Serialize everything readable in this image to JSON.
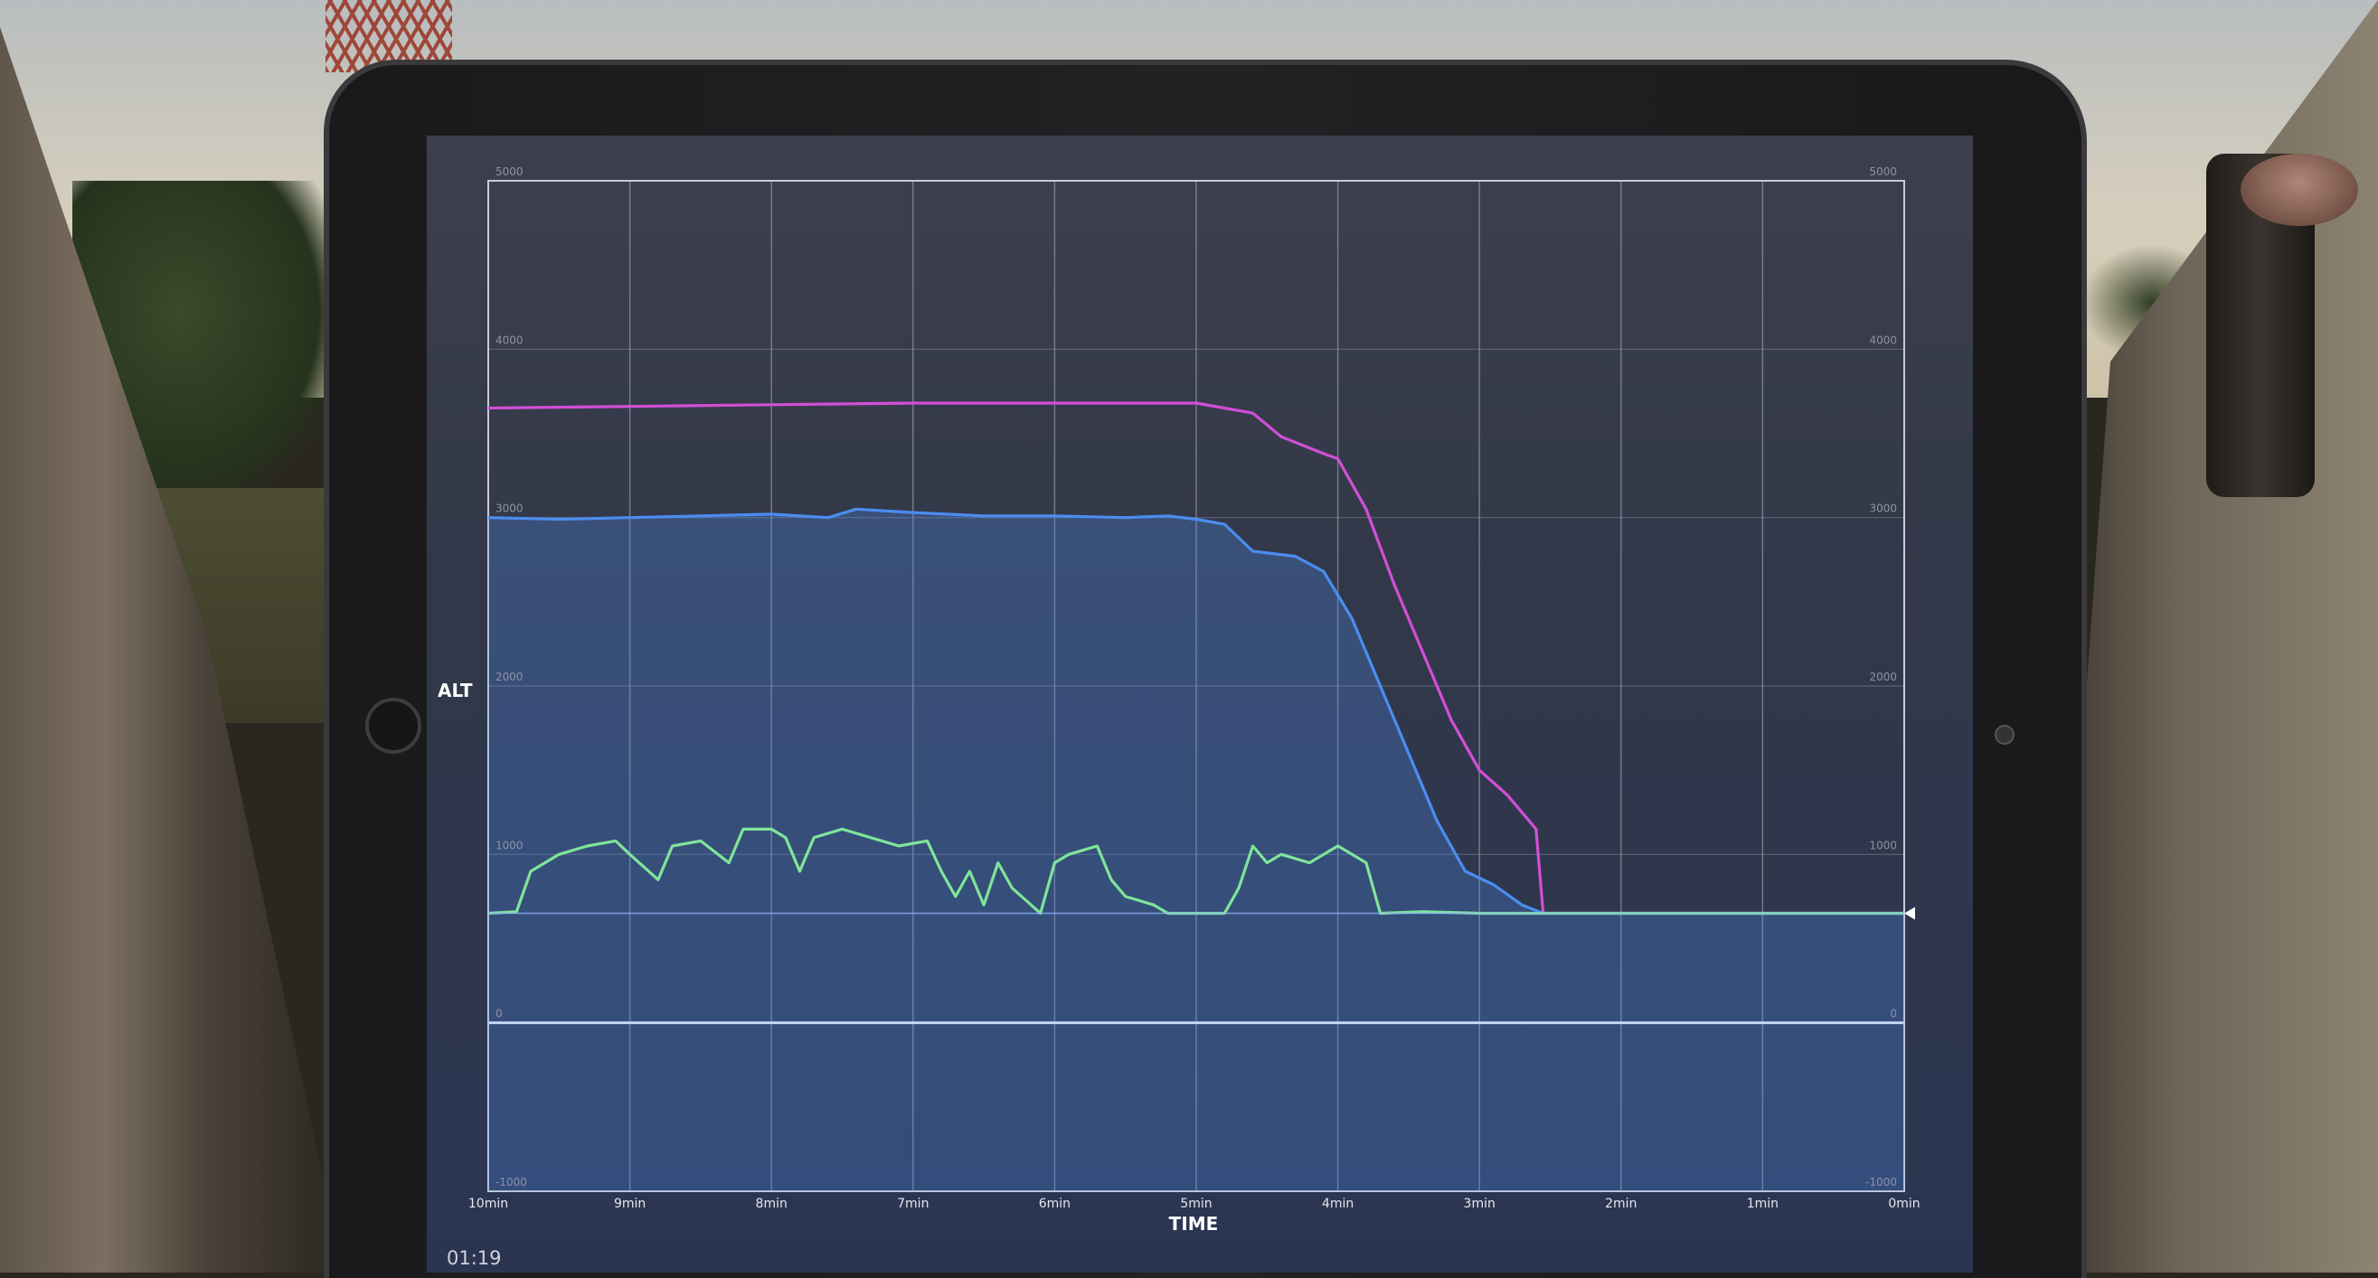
{
  "screen": {
    "clock": "01:19"
  },
  "chart_data": {
    "type": "line",
    "title": "",
    "xlabel": "TIME",
    "ylabel": "ALT",
    "x_tick_labels": [
      "10min",
      "9min",
      "8min",
      "7min",
      "6min",
      "5min",
      "4min",
      "3min",
      "2min",
      "1min",
      "0min"
    ],
    "y_tick_labels": [
      "5000",
      "4000",
      "3000",
      "2000",
      "1000",
      "0",
      "-1000"
    ],
    "xlim": [
      10,
      0
    ],
    "ylim": [
      -1000,
      5000
    ],
    "grid": true,
    "current_marker": {
      "x": 0,
      "y": 650
    },
    "series": [
      {
        "color": "#d24fd6",
        "points": [
          [
            10,
            3650
          ],
          [
            9,
            3660
          ],
          [
            8,
            3670
          ],
          [
            7,
            3680
          ],
          [
            6,
            3680
          ],
          [
            5.5,
            3680
          ],
          [
            5.0,
            3680
          ],
          [
            4.6,
            3620
          ],
          [
            4.4,
            3480
          ],
          [
            4.1,
            3380
          ],
          [
            4.0,
            3350
          ],
          [
            3.8,
            3050
          ],
          [
            3.6,
            2600
          ],
          [
            3.4,
            2200
          ],
          [
            3.2,
            1800
          ],
          [
            3.0,
            1500
          ],
          [
            2.8,
            1350
          ],
          [
            2.6,
            1150
          ],
          [
            2.55,
            650
          ],
          [
            2,
            650
          ],
          [
            1,
            650
          ],
          [
            0,
            650
          ]
        ]
      },
      {
        "color": "#4b8df0",
        "fill": true,
        "points": [
          [
            10,
            3000
          ],
          [
            9.5,
            2990
          ],
          [
            9,
            3000
          ],
          [
            8.5,
            3010
          ],
          [
            8,
            3020
          ],
          [
            7.6,
            3000
          ],
          [
            7.4,
            3050
          ],
          [
            7,
            3030
          ],
          [
            6.5,
            3010
          ],
          [
            6,
            3010
          ],
          [
            5.5,
            3000
          ],
          [
            5.2,
            3010
          ],
          [
            5.0,
            2990
          ],
          [
            4.8,
            2960
          ],
          [
            4.6,
            2800
          ],
          [
            4.3,
            2770
          ],
          [
            4.1,
            2680
          ],
          [
            3.9,
            2400
          ],
          [
            3.7,
            2000
          ],
          [
            3.5,
            1600
          ],
          [
            3.3,
            1200
          ],
          [
            3.1,
            900
          ],
          [
            2.9,
            820
          ],
          [
            2.7,
            700
          ],
          [
            2.55,
            650
          ],
          [
            2,
            650
          ],
          [
            1,
            650
          ],
          [
            0,
            650
          ]
        ]
      },
      {
        "color": "#7ee59a",
        "points": [
          [
            10,
            650
          ],
          [
            9.8,
            660
          ],
          [
            9.7,
            900
          ],
          [
            9.5,
            1000
          ],
          [
            9.3,
            1050
          ],
          [
            9.1,
            1080
          ],
          [
            9.0,
            1000
          ],
          [
            8.8,
            850
          ],
          [
            8.7,
            1050
          ],
          [
            8.5,
            1080
          ],
          [
            8.3,
            950
          ],
          [
            8.2,
            1150
          ],
          [
            8.0,
            1150
          ],
          [
            7.9,
            1100
          ],
          [
            7.8,
            900
          ],
          [
            7.7,
            1100
          ],
          [
            7.5,
            1150
          ],
          [
            7.3,
            1100
          ],
          [
            7.1,
            1050
          ],
          [
            6.9,
            1080
          ],
          [
            6.8,
            900
          ],
          [
            6.7,
            750
          ],
          [
            6.6,
            900
          ],
          [
            6.5,
            700
          ],
          [
            6.4,
            950
          ],
          [
            6.3,
            800
          ],
          [
            6.1,
            650
          ],
          [
            6.0,
            950
          ],
          [
            5.9,
            1000
          ],
          [
            5.7,
            1050
          ],
          [
            5.6,
            850
          ],
          [
            5.5,
            750
          ],
          [
            5.3,
            700
          ],
          [
            5.2,
            650
          ],
          [
            5.0,
            650
          ],
          [
            4.8,
            650
          ],
          [
            4.7,
            800
          ],
          [
            4.6,
            1050
          ],
          [
            4.5,
            950
          ],
          [
            4.4,
            1000
          ],
          [
            4.2,
            950
          ],
          [
            4.0,
            1050
          ],
          [
            3.9,
            1000
          ],
          [
            3.8,
            950
          ],
          [
            3.7,
            650
          ],
          [
            3.4,
            660
          ],
          [
            3.0,
            650
          ],
          [
            2.55,
            650
          ],
          [
            2,
            650
          ],
          [
            1,
            650
          ],
          [
            0,
            650
          ]
        ]
      }
    ]
  }
}
